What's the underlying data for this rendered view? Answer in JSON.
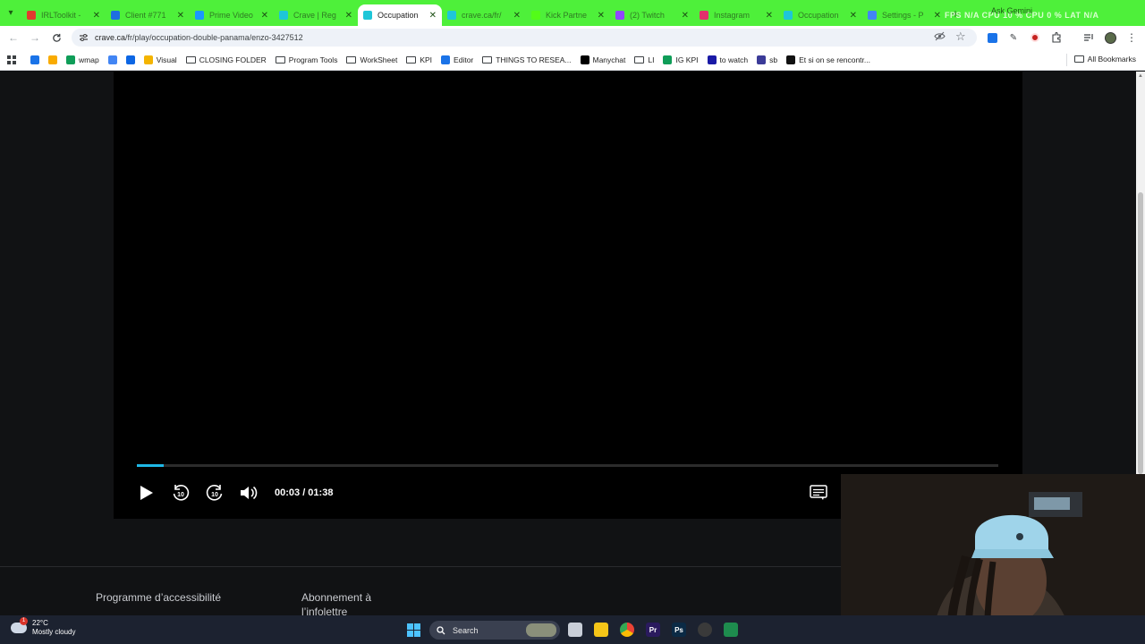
{
  "tabs": [
    {
      "title": "IRLToolkit -",
      "favicon_color": "#e23b2e"
    },
    {
      "title": "Client #771",
      "favicon_color": "#1d6fe0"
    },
    {
      "title": "Prime Video",
      "favicon_color": "#1a98ff"
    },
    {
      "title": "Crave | Reg",
      "favicon_color": "#1ec6d8"
    },
    {
      "title": "Occupation",
      "favicon_color": "#1ec6d8",
      "active": true
    },
    {
      "title": "crave.ca/fr/",
      "favicon_color": "#1ec6d8"
    },
    {
      "title": "Kick Partne",
      "favicon_color": "#53fc18"
    },
    {
      "title": "(2) Twitch",
      "favicon_color": "#9146ff"
    },
    {
      "title": "Instagram",
      "favicon_color": "#e1306c"
    },
    {
      "title": "Occupation",
      "favicon_color": "#1ec6d8"
    },
    {
      "title": "Settings - P",
      "favicon_color": "#4285f4"
    }
  ],
  "gemini_label": "Ask Gemini",
  "overlay_stats": "FPS N/A   CPU 10 %   CPU 0 %   LAT N/A",
  "address": {
    "host": "crave.ca",
    "path": "/fr/play/occupation-double-panama/enzo-3427512"
  },
  "bookmarks": [
    {
      "label": "",
      "icon": "calendar-icon",
      "color": "#1a73e8"
    },
    {
      "label": "",
      "icon": "meet-icon",
      "color": "#f9ab00"
    },
    {
      "label": "wmap",
      "icon": "wmap-icon",
      "color": "#0f9d58"
    },
    {
      "label": "",
      "icon": "sparkle-icon",
      "color": "#4285f4"
    },
    {
      "label": "",
      "icon": "trello-icon",
      "color": "#0c66e4"
    },
    {
      "label": "Visual",
      "icon": "visual-icon",
      "color": "#f4b400"
    },
    {
      "label": "CLOSING FOLDER",
      "icon": "folder-icon"
    },
    {
      "label": "Program Tools",
      "icon": "folder-icon"
    },
    {
      "label": "WorkSheet",
      "icon": "folder-icon"
    },
    {
      "label": "KPI",
      "icon": "folder-icon"
    },
    {
      "label": "Editor",
      "icon": "editor-icon",
      "color": "#1a73e8"
    },
    {
      "label": "THINGS TO RESEA...",
      "icon": "folder-icon"
    },
    {
      "label": "Manychat",
      "icon": "manychat-icon",
      "color": "#000000"
    },
    {
      "label": "LI",
      "icon": "folder-icon"
    },
    {
      "label": "IG KPI",
      "icon": "sheets-icon",
      "color": "#0f9d58"
    },
    {
      "label": "to watch",
      "icon": "watch-icon",
      "color": "#1a1aa6"
    },
    {
      "label": "sb",
      "icon": "sb-icon",
      "color": "#3b3b98"
    },
    {
      "label": "Et si on se rencontr...",
      "icon": "rencontre-icon",
      "color": "#111111"
    }
  ],
  "all_bookmarks_label": "All Bookmarks",
  "player": {
    "current_time": "00:03",
    "duration": "01:38",
    "time_display": "00:03 / 01:38",
    "progress": 0.031,
    "skip_back_seconds": "10",
    "skip_forward_seconds": "10",
    "accent_color": "#1fb8e6"
  },
  "footer": {
    "accessibility_link": "Programme d’accessibilité",
    "newsletter_link_line1": "Abonnement à",
    "newsletter_link_line2": "l’infolettre"
  },
  "taskbar": {
    "weather_temp": "22°C",
    "weather_desc": "Mostly cloudy",
    "weather_badge": "1",
    "search_placeholder": "Search",
    "apps": [
      {
        "name": "task-view-icon",
        "label": "",
        "color": "#c9ced8"
      },
      {
        "name": "file-explorer-icon",
        "label": "",
        "color": "#f5c518"
      },
      {
        "name": "chrome-icon",
        "label": "",
        "color": "#e94235"
      },
      {
        "name": "premiere-pro-icon",
        "label": "Pr",
        "color": "#2a1a5e"
      },
      {
        "name": "photoshop-icon",
        "label": "Ps",
        "color": "#0b2a45"
      },
      {
        "name": "obs-icon",
        "label": "",
        "color": "#3a3a3a"
      },
      {
        "name": "app-icon",
        "label": "",
        "color": "#1e8c4e"
      }
    ]
  }
}
